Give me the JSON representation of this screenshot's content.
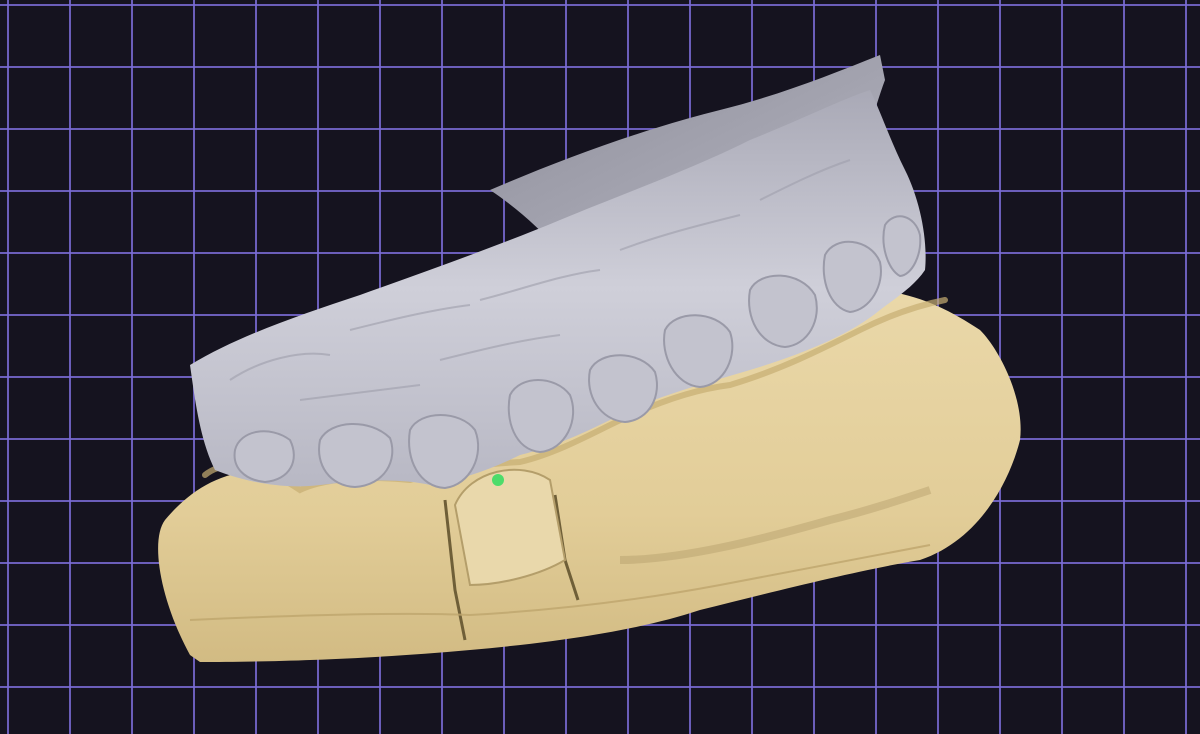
{
  "viewport": {
    "background_color": "#15131f",
    "grid": {
      "line_color": "#7a6cd6",
      "visible": true
    }
  },
  "scan_model": {
    "upper_arch": {
      "color": "#c9c9d3",
      "shadow_color": "#8c8c99"
    },
    "lower_arch": {
      "color": "#e6d3a3",
      "shadow_color": "#b49e6a"
    },
    "selection_marker": {
      "color": "#4ddc6a"
    }
  }
}
